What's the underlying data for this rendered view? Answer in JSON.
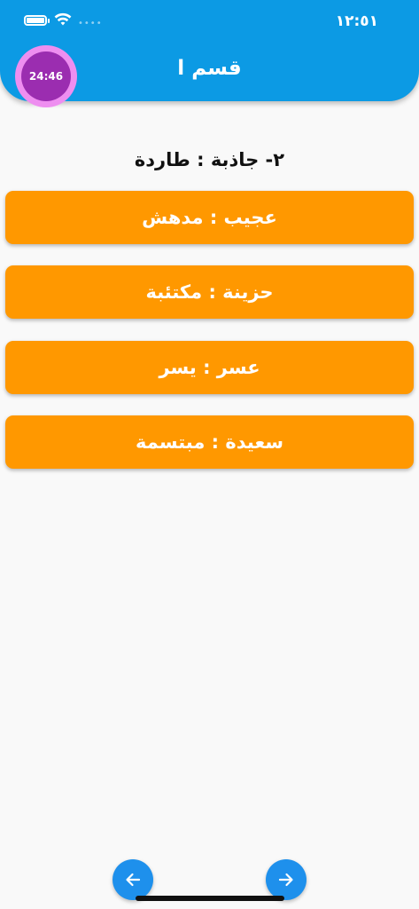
{
  "status_bar": {
    "time": "١٢:٥١",
    "battery_icon": "battery-icon",
    "wifi_icon": "wifi-icon",
    "signal_dots": "••••"
  },
  "header": {
    "title": "قسم ا",
    "timer": "24:46",
    "background_color": "#0c9ae4"
  },
  "question": {
    "text": "٢- جاذبة : طاردة"
  },
  "options": [
    {
      "label": "عجيب : مدهش"
    },
    {
      "label": "حزينة : مكتئبة"
    },
    {
      "label": "عسر : يسر"
    },
    {
      "label": "سعيدة : مبتسمة"
    }
  ],
  "option_color": "#ff9800",
  "navigation": {
    "prev_icon": "arrow-left-icon",
    "next_icon": "arrow-right-icon",
    "button_color": "#1e90ec"
  }
}
